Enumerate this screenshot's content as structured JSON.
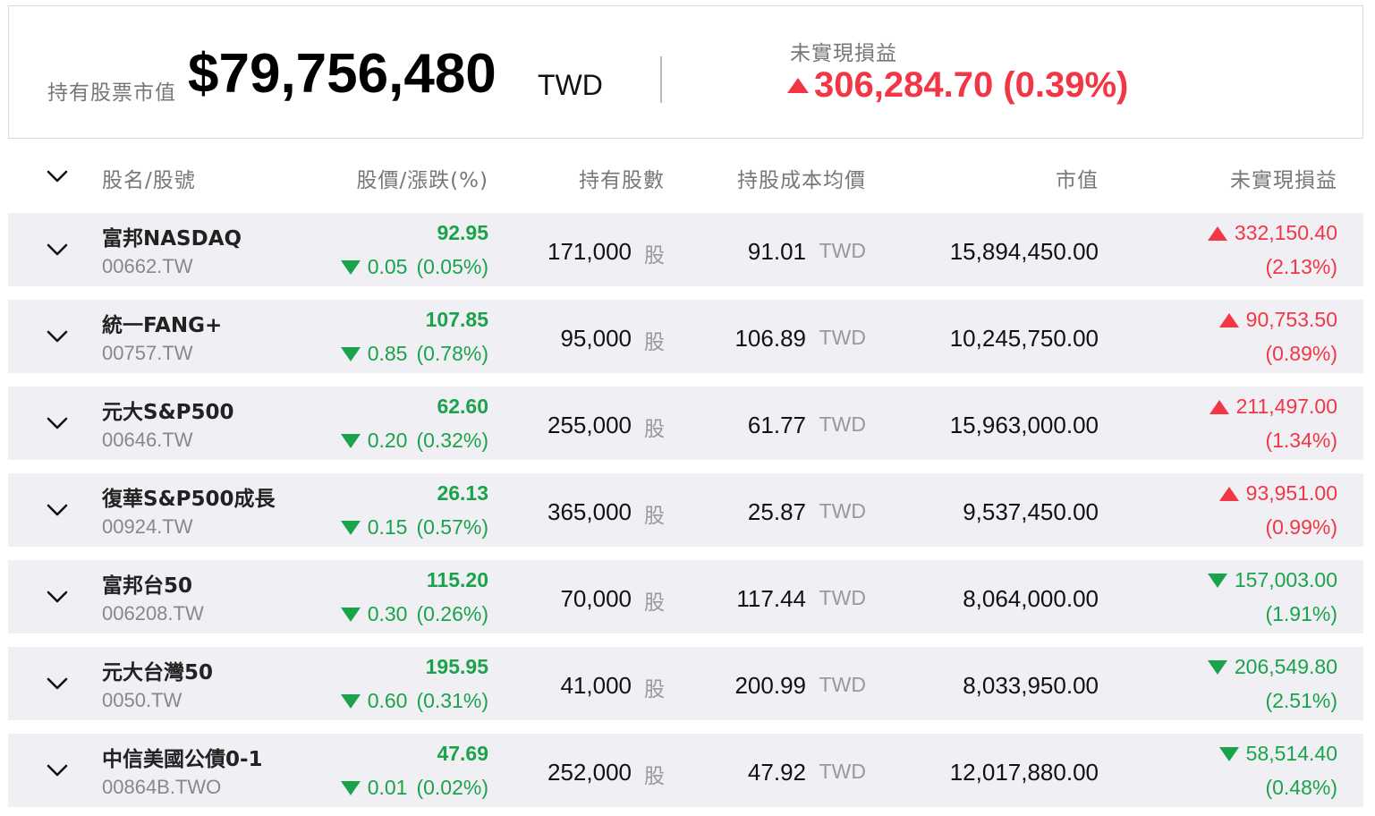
{
  "summary": {
    "market_value_label": "持有股票市值",
    "market_value": "$79,756,480",
    "currency": "TWD",
    "unrealized_label": "未實現損益",
    "unrealized_value": "306,284.70 (0.39%)",
    "unrealized_direction": "up"
  },
  "columns": {
    "name": "股名/股號",
    "price": "股價/漲跌(%)",
    "shares": "持有股數",
    "avg_cost": "持股成本均價",
    "market_value": "市值",
    "unrealized": "未實現損益"
  },
  "units": {
    "shares": "股",
    "currency": "TWD"
  },
  "colors": {
    "up": "#f23645",
    "down": "#1aa34a",
    "row_bg": "#f0f0f4"
  },
  "holdings": [
    {
      "name": "富邦NASDAQ",
      "code": "00662.TW",
      "price": "92.95",
      "change": "0.05",
      "change_pct": "(0.05%)",
      "change_dir": "down",
      "shares": "171,000",
      "avg_cost": "91.01",
      "market_value": "15,894,450.00",
      "pl": "332,150.40",
      "pl_pct": "(2.13%)",
      "pl_dir": "up"
    },
    {
      "name": "統一FANG+",
      "code": "00757.TW",
      "price": "107.85",
      "change": "0.85",
      "change_pct": "(0.78%)",
      "change_dir": "down",
      "shares": "95,000",
      "avg_cost": "106.89",
      "market_value": "10,245,750.00",
      "pl": "90,753.50",
      "pl_pct": "(0.89%)",
      "pl_dir": "up"
    },
    {
      "name": "元大S&P500",
      "code": "00646.TW",
      "price": "62.60",
      "change": "0.20",
      "change_pct": "(0.32%)",
      "change_dir": "down",
      "shares": "255,000",
      "avg_cost": "61.77",
      "market_value": "15,963,000.00",
      "pl": "211,497.00",
      "pl_pct": "(1.34%)",
      "pl_dir": "up"
    },
    {
      "name": "復華S&P500成長",
      "code": "00924.TW",
      "price": "26.13",
      "change": "0.15",
      "change_pct": "(0.57%)",
      "change_dir": "down",
      "shares": "365,000",
      "avg_cost": "25.87",
      "market_value": "9,537,450.00",
      "pl": "93,951.00",
      "pl_pct": "(0.99%)",
      "pl_dir": "up"
    },
    {
      "name": "富邦台50",
      "code": "006208.TW",
      "price": "115.20",
      "change": "0.30",
      "change_pct": "(0.26%)",
      "change_dir": "down",
      "shares": "70,000",
      "avg_cost": "117.44",
      "market_value": "8,064,000.00",
      "pl": "157,003.00",
      "pl_pct": "(1.91%)",
      "pl_dir": "down"
    },
    {
      "name": "元大台灣50",
      "code": "0050.TW",
      "price": "195.95",
      "change": "0.60",
      "change_pct": "(0.31%)",
      "change_dir": "down",
      "shares": "41,000",
      "avg_cost": "200.99",
      "market_value": "8,033,950.00",
      "pl": "206,549.80",
      "pl_pct": "(2.51%)",
      "pl_dir": "down"
    },
    {
      "name": "中信美國公債0-1",
      "code": "00864B.TWO",
      "price": "47.69",
      "change": "0.01",
      "change_pct": "(0.02%)",
      "change_dir": "down",
      "shares": "252,000",
      "avg_cost": "47.92",
      "market_value": "12,017,880.00",
      "pl": "58,514.40",
      "pl_pct": "(0.48%)",
      "pl_dir": "down"
    }
  ]
}
